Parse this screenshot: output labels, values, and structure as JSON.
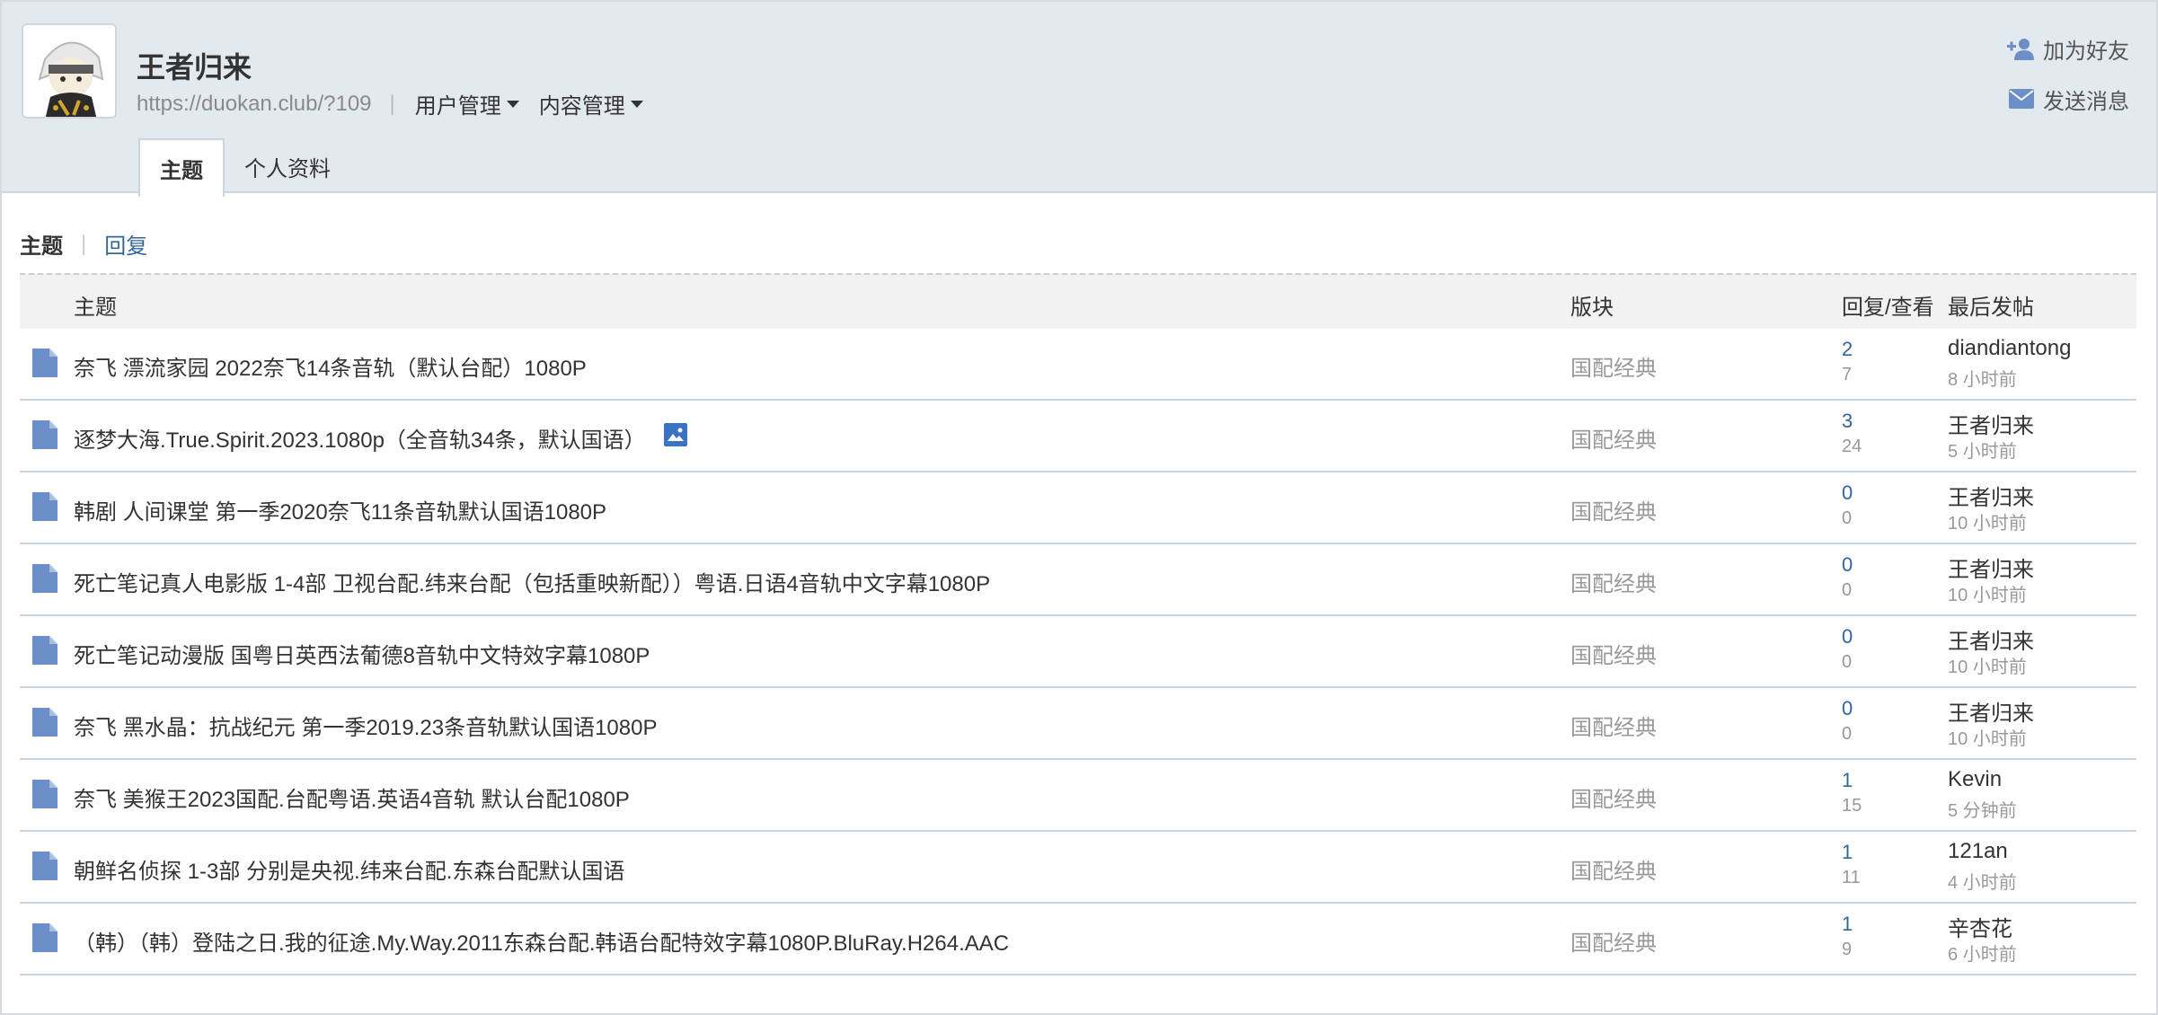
{
  "profile": {
    "name": "王者归来",
    "url": "https://duokan.club/?109",
    "menus": [
      "用户管理",
      "内容管理"
    ],
    "actions": {
      "add_friend": "加为好友",
      "send_message": "发送消息"
    },
    "tabs": [
      "主题",
      "个人资料"
    ]
  },
  "subnav": {
    "active": "主题",
    "other": "回复"
  },
  "table": {
    "headers": {
      "subject": "主题",
      "forum": "版块",
      "replies_views": "回复/查看",
      "last_post": "最后发帖"
    },
    "rows": [
      {
        "title": "奈飞 漂流家园 2022奈飞14条音轨（默认台配）1080P",
        "forum": "国配经典",
        "replies": "2",
        "views": "7",
        "poster": "diandiantong",
        "time": "8 小时前",
        "has_image": false
      },
      {
        "title": "逐梦大海.True.Spirit.2023.1080p（全音轨34条，默认国语）",
        "forum": "国配经典",
        "replies": "3",
        "views": "24",
        "poster": "王者归来",
        "time": "5 小时前",
        "has_image": true
      },
      {
        "title": "韩剧 人间课堂 第一季2020奈飞11条音轨默认国语1080P",
        "forum": "国配经典",
        "replies": "0",
        "views": "0",
        "poster": "王者归来",
        "time": "10 小时前",
        "has_image": false
      },
      {
        "title": "死亡笔记真人电影版 1-4部 卫视台配.纬来台配（包括重映新配））粤语.日语4音轨中文字幕1080P",
        "forum": "国配经典",
        "replies": "0",
        "views": "0",
        "poster": "王者归来",
        "time": "10 小时前",
        "has_image": false
      },
      {
        "title": "死亡笔记动漫版 国粤日英西法葡德8音轨中文特效字幕1080P",
        "forum": "国配经典",
        "replies": "0",
        "views": "0",
        "poster": "王者归来",
        "time": "10 小时前",
        "has_image": false
      },
      {
        "title": "奈飞 黑水晶：抗战纪元 第一季2019.23条音轨默认国语1080P",
        "forum": "国配经典",
        "replies": "0",
        "views": "0",
        "poster": "王者归来",
        "time": "10 小时前",
        "has_image": false
      },
      {
        "title": "奈飞 美猴王2023国配.台配粤语.英语4音轨 默认台配1080P",
        "forum": "国配经典",
        "replies": "1",
        "views": "15",
        "poster": "Kevin",
        "time": "5 分钟前",
        "has_image": false
      },
      {
        "title": "朝鲜名侦探 1-3部 分别是央视.纬来台配.东森台配默认国语",
        "forum": "国配经典",
        "replies": "1",
        "views": "11",
        "poster": "121an",
        "time": "4 小时前",
        "has_image": false
      },
      {
        "title": "（韩）（韩）登陆之日.我的征途.My.Way.2011东森台配.韩语台配特效字幕1080P.BluRay.H264.AAC",
        "forum": "国配经典",
        "replies": "1",
        "views": "9",
        "poster": "辛杏花",
        "time": "6 小时前",
        "has_image": false
      }
    ]
  },
  "colors": {
    "header_bg": "#e3eaef",
    "link": "#336699",
    "doc_icon": "#6d8fc7",
    "row_border": "#c5d5e4"
  },
  "icons": {
    "row": "document-icon",
    "image": "image-icon",
    "add_friend": "add-user-icon",
    "message": "envelope-icon"
  }
}
